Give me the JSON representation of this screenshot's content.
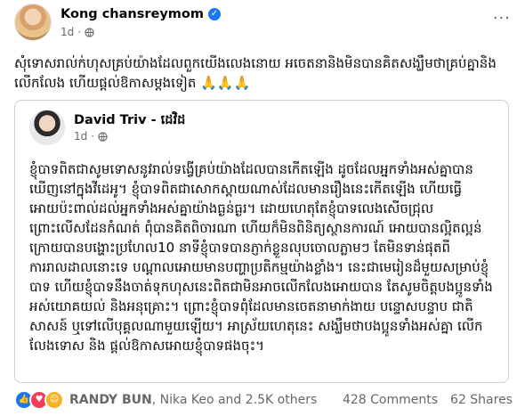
{
  "post": {
    "author": "Kong chansreymom",
    "time": "1d",
    "caption": "សុំទោសរាល់ក់ហុសគ្រប់យ៉ាងដែលពួកយើងលេងនោយ អចេតនានិងមិនបានគិតសង្ឃឹមថាគ្រប់គ្នានិង លើកលែង ហើយផ្ដល់ឱកាសម្ដងទៀត 🙏🙏🙏"
  },
  "shared_post": {
    "author": "David Triv - ដេវិដ",
    "time": "1d",
    "body": "ខ្ញុំបាទពិតជាសូមទោសនូវរាល់ទង្វើគ្រប់យ៉ាងដែលបានកើតឡើង ដូចដែលអ្នកទាំងអស់គ្នាបានឃើញនៅក្នុងវីដេអូ។ ខ្ញុំបាទពិតជាសោកស្ដាយណាស់ដែលមានរឿងនេះកើតឡើង ហើយធ្វើអោយប៉ះពាល់ដល់អ្នកទាំងអស់គ្នាយ៉ាងធ្ងន់ធ្ងរ។ ដោយហេតុតែខ្ញុំបាទលេងសើចជ្រុលព្រោះលើសដែនកំណត់ ពុំបានគិតពិចារណា ហើយក៏មិនពិនិត្យស្ថានការណ៍ អោយបានល្អិតល្អន់ ក្រោយបានបង្ហោះប្រហែល10 នាទីខ្ញុំបាទបានភ្ញាក់ខ្លួនលុបចោលភ្លាមៗ តែមិនទាន់ផុតពីការរាលដាលនោះទេ បណ្ដាលអោយមានបញ្ហាប្រតិកម្មយ៉ាងខ្លាំង។ នេះជាមេរៀនដ៏មួយសម្រាប់ខ្ញុំបាទ ហើយខ្ញុំបាទនឹងចាត់ទុកហុសនេះពិតជាមិនអាចលើកលែងអោយបាន តែសូមចិត្តបងប្អូនទាំងអស់យោគយល់ និងអនុគ្រោះ។ ព្រោះខ្ញុំបាទពុំដែលមានចេតនាមាក់ងាយ បន្ទោសបន្ទាប ជាតិសាសន៍ ឬទៅលើបុគ្គលណាមួយឡើយ។ អាស្រ័យហេតុនេះ សង្ឃឹមថាបងប្អូនទាំងអស់គ្នា លើកលែងទោស និង ផ្ដល់ឱកាសអោយខ្ញុំបាទផងចុះ។"
  },
  "reactions": {
    "icons": [
      "like-icon",
      "love-icon",
      "care-icon"
    ],
    "first_name": "RANDY BUN",
    "rest": ", Nika Keo and 2.5K others"
  },
  "counts": {
    "comments": "428 Comments",
    "shares": "62 Shares"
  },
  "colors": {
    "accent": "#1877f2",
    "secondary_text": "#65676b",
    "border": "#ced0d4"
  }
}
